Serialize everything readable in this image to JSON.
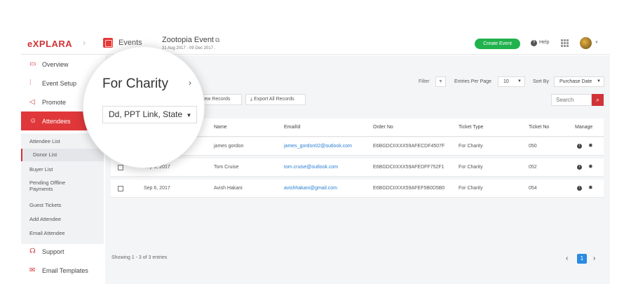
{
  "topbar": {
    "logo": "eXPLARA",
    "events_label": "Events",
    "event_title": "Zootopia Event",
    "event_dates": "31 Aug 2017 - 09 Dec 2017 .",
    "create_button": "Create Event",
    "help_label": "Help",
    "colors": {
      "brand": "#d03337",
      "create": "#21b24d"
    }
  },
  "sidebar": {
    "items": [
      {
        "label": "Overview",
        "icon": "monitor-icon"
      },
      {
        "label": "Event Setup",
        "icon": "sliders-icon"
      },
      {
        "label": "Promote",
        "icon": "megaphone-icon"
      },
      {
        "label": "Attendees",
        "icon": "users-icon",
        "active": true
      }
    ],
    "sub_items": [
      "Attendee List",
      "Donor List",
      "Buyer List",
      "Pending Offline Payments",
      "Guest Tickets",
      "Add Attendee",
      "Email Attendee"
    ],
    "bottom_items": [
      {
        "label": "Support",
        "icon": "headset-icon"
      },
      {
        "label": "Email Templates",
        "icon": "envelope-icon"
      }
    ]
  },
  "toolbar": {
    "filter_label": "Filter",
    "entries_label": "Entries Per Page",
    "entries_value": "10",
    "sort_label": "Sort By",
    "sort_value": "Purchase Date",
    "export_few": "ort Few Records",
    "export_all": "Export All Records",
    "search_placeholder": "Search"
  },
  "magnifier": {
    "title": "For Charity",
    "select_value": "Dd, PPT Link, State"
  },
  "table": {
    "headers": [
      "Name",
      "EmailId",
      "Order No",
      "Ticket Type",
      "Ticket No",
      "Manage"
    ],
    "rows": [
      {
        "date": "",
        "name": "james gordon",
        "email": "james_gordon02@outlook.com",
        "order": "E6BGDCIIXXX59AFECDF4507F",
        "type": "For Charity",
        "ticket": "050"
      },
      {
        "date": "Sep 6, 2017",
        "name": "Tom Cruise",
        "email": "tom.cruise@outlook.com",
        "order": "E6BGDCIIXXX59AFEDFF752F1",
        "type": "For Charity",
        "ticket": "052"
      },
      {
        "date": "Sep 6, 2017",
        "name": "Avish Hakani",
        "email": "avishhakani@gmail.com",
        "order": "E6BGDCIIXXX59AFEF5B0D5B0",
        "type": "For Charity",
        "ticket": "054"
      }
    ]
  },
  "footer": {
    "showing": "Showing 1 - 3 of 3 entries",
    "page": "1"
  }
}
